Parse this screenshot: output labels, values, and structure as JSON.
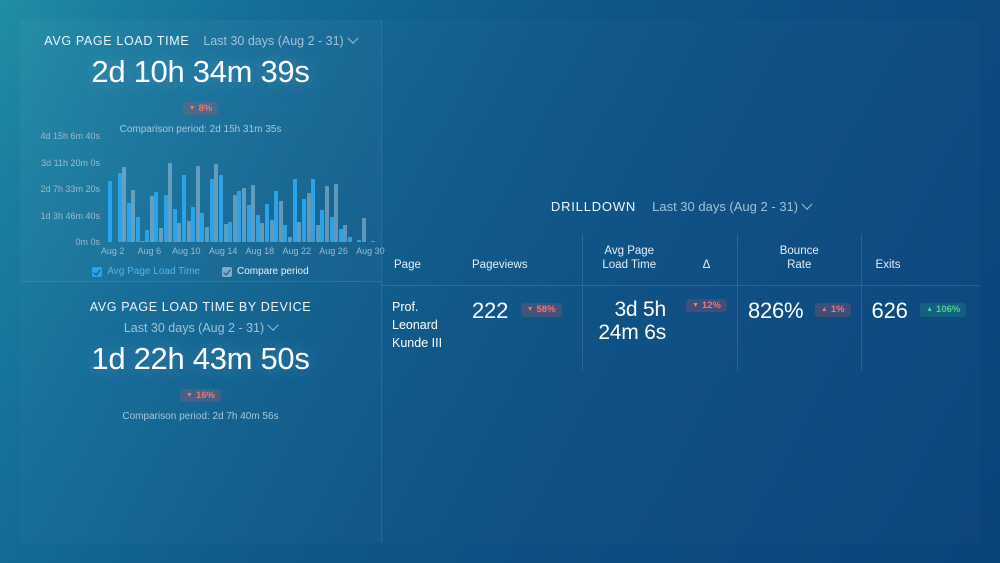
{
  "theme": {
    "accent_blue": "#2aa3e8",
    "negative_red": "#f2756e",
    "positive_green": "#46d29b",
    "bg_gradient_from": "#1f8fa3",
    "bg_gradient_to": "#0a437a"
  },
  "widget_load_time": {
    "title": "AVG PAGE LOAD TIME",
    "date_range": "Last 30 days (Aug 2 - 31)",
    "value": "2d 10h 34m 39s",
    "delta": {
      "direction": "down",
      "arrow": "▼",
      "text": "8%"
    },
    "comparison": "Comparison period: 2d 15h 31m 35s",
    "legend": [
      {
        "label": "Avg Page Load Time",
        "checked": true,
        "color": "blue"
      },
      {
        "label": "Compare period",
        "checked": true,
        "color": "grey"
      }
    ]
  },
  "widget_load_time_by_device": {
    "title": "AVG PAGE LOAD TIME BY DEVICE",
    "date_range": "Last 30 days (Aug 2 - 31)",
    "value": "1d 22h 43m 50s",
    "delta": {
      "direction": "down",
      "arrow": "▼",
      "text": "16%"
    },
    "comparison": "Comparison period: 2d 7h 40m 56s"
  },
  "drilldown": {
    "title": "DRILLDOWN",
    "date_range": "Last 30 days (Aug 2 - 31)",
    "columns": [
      {
        "key": "page",
        "label": "Page"
      },
      {
        "key": "pageviews",
        "label": "Pageviews"
      },
      {
        "key": "avg_load",
        "label": "Avg Page\nLoad Time"
      },
      {
        "key": "delta",
        "label": "Δ"
      },
      {
        "key": "bounce",
        "label": "Bounce\nRate"
      },
      {
        "key": "exits",
        "label": "Exits"
      }
    ],
    "column_labels": {
      "page": "Page",
      "pageviews": "Pageviews",
      "avg_load_l1": "Avg Page",
      "avg_load_l2": "Load Time",
      "delta": "Δ",
      "bounce_l1": "Bounce",
      "bounce_l2": "Rate",
      "exits": "Exits"
    },
    "rows": [
      {
        "page": "Prof. Leonard Kunde III",
        "pageviews": "222",
        "pageviews_delta": {
          "direction": "down",
          "arrow": "▼",
          "text": "58%"
        },
        "avg_load": "3d 5h 24m 6s",
        "avg_load_delta": {
          "direction": "down",
          "arrow": "▼",
          "text": "12%"
        },
        "bounce_rate": "826%",
        "bounce_delta": {
          "direction": "up-red",
          "arrow": "▲",
          "text": "1%"
        },
        "exits": "626",
        "exits_delta": {
          "direction": "up-green",
          "arrow": "▲",
          "text": "106%"
        }
      }
    ]
  },
  "chart_data": {
    "type": "bar",
    "title": "Avg Page Load Time",
    "xlabel": "",
    "ylabel": "",
    "grid": false,
    "legend_position": "bottom",
    "y_tick_labels": [
      "0m 0s",
      "1d 3h 46m 40s",
      "2d 7h 33m 20s",
      "3d 11h 20m 0s",
      "4d 15h 6m 40s"
    ],
    "y_tick_values": [
      0,
      100000,
      200000,
      300000,
      400000
    ],
    "ylim": [
      0,
      400000
    ],
    "x_tick_labels": [
      "Aug 2",
      "Aug 6",
      "Aug 10",
      "Aug 14",
      "Aug 18",
      "Aug 22",
      "Aug 26",
      "Aug 30"
    ],
    "x_tick_positions": [
      0,
      4,
      8,
      12,
      16,
      20,
      24,
      28
    ],
    "categories": [
      "Aug 2",
      "Aug 3",
      "Aug 4",
      "Aug 5",
      "Aug 6",
      "Aug 7",
      "Aug 8",
      "Aug 9",
      "Aug 10",
      "Aug 11",
      "Aug 12",
      "Aug 13",
      "Aug 14",
      "Aug 15",
      "Aug 16",
      "Aug 17",
      "Aug 18",
      "Aug 19",
      "Aug 20",
      "Aug 21",
      "Aug 22",
      "Aug 23",
      "Aug 24",
      "Aug 25",
      "Aug 26",
      "Aug 27",
      "Aug 28",
      "Aug 29",
      "Aug 30"
    ],
    "series": [
      {
        "name": "Avg Page Load Time",
        "color": "#2aa3e8",
        "values": [
          232000,
          262000,
          148000,
          96000,
          44000,
          188000,
          176000,
          124000,
          252000,
          132000,
          108000,
          236000,
          252000,
          74000,
          194000,
          140000,
          102000,
          142000,
          194000,
          66000,
          236000,
          162000,
          238000,
          120000,
          96000,
          48000,
          18000,
          8000,
          0
        ]
      },
      {
        "name": "Compare period",
        "color": "rgba(200,222,236,0.42)",
        "values": [
          0,
          284000,
          196000,
          4000,
          172000,
          52000,
          300000,
          70000,
          80000,
          286000,
          56000,
          294000,
          68000,
          176000,
          204000,
          216000,
          72000,
          84000,
          156000,
          18000,
          74000,
          186000,
          66000,
          210000,
          218000,
          64000,
          0,
          90000,
          4000
        ]
      }
    ]
  }
}
